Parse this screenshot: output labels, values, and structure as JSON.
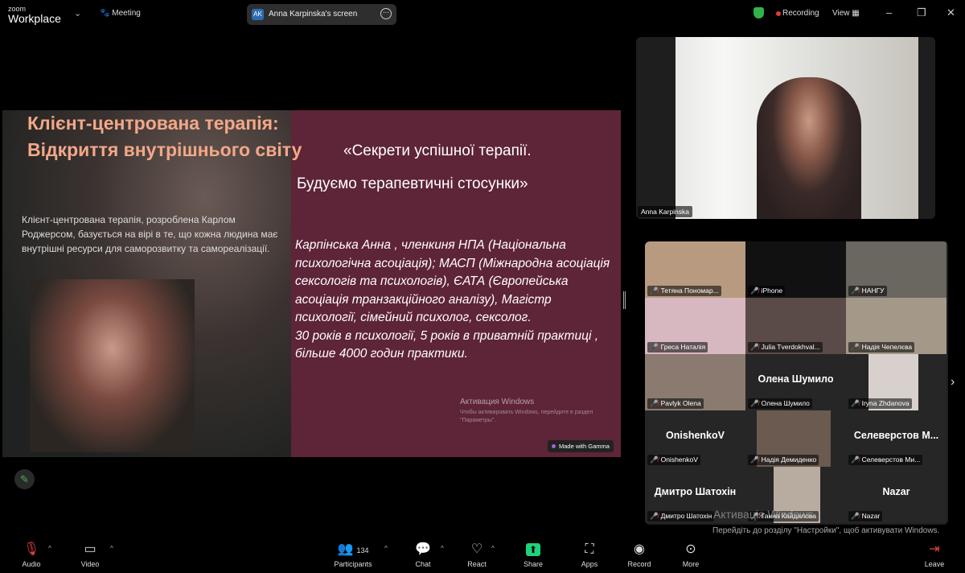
{
  "app": {
    "logo_small": "zoom",
    "logo_big": "Workplace",
    "meeting_label": "Meeting"
  },
  "share_pill": {
    "initials": "AK",
    "label": "Anna Karpinska's screen"
  },
  "status": {
    "recording": "Recording",
    "view": "View"
  },
  "slide": {
    "title": "Клієнт-центрована терапія: Відкриття внутрішнього світу",
    "body": "Клієнт-центрована терапія, розроблена Карлом Роджерсом, базується на вірі в те, що кожна людина має внутрішні ресурси для саморозвитку та самореалізації.",
    "quote_line1": "«Секрети успішної терапії.",
    "quote_line2": "Будуємо терапевтичні стосунки»",
    "bio": "Карпінська Анна , членкиня НПА (Національна психологічна асоціація); МАСП (Міжнародна асоціація сексологів та психологів), ЄАТА (Європейська асоціація транзакційного аналізу), Магістр психології, сімейний психолог, сексолог.",
    "bio2": "30 років в психології, 5 років в приватній практиці , більше 4000 годин практики.",
    "activation_title": "Активация Windows",
    "activation_text": "Чтобы активировать Windows, перейдите в раздел \"Параметры\".",
    "badge": "Made with Gamma"
  },
  "speaker": {
    "name": "Anna Karpinska"
  },
  "participants": [
    {
      "name": "Тетяна Пономар...",
      "video": true,
      "bg": "#b89a80"
    },
    {
      "name": "iPhone",
      "video": true,
      "bg": "#111"
    },
    {
      "name": "НАНГУ",
      "video": true,
      "bg": "#6a6660"
    },
    {
      "name": "Греса Наталія",
      "video": true,
      "bg": "#d8b8c0"
    },
    {
      "name": "Julia Tverdokhval...",
      "video": true,
      "bg": "#5a4a48"
    },
    {
      "name": "Надія Чепелєва",
      "video": true,
      "bg": "#a49888"
    },
    {
      "name": "Pavlyk Olena",
      "video": true,
      "bg": "#8a7a70"
    },
    {
      "name": "Олена Шумило",
      "video": false,
      "big": "Олена Шумило"
    },
    {
      "name": "Iryna Zhdanova",
      "video": true,
      "bg": "#d8d0cc"
    },
    {
      "name": "OnishenkoV",
      "video": false,
      "big": "OnishenkoV"
    },
    {
      "name": "Надія Демиденко",
      "video": true,
      "bg": "#6a5a50"
    },
    {
      "name": "Селеверстов Ми...",
      "video": false,
      "big": "Селеверстов  M..."
    },
    {
      "name": "Дмитро Шатохін",
      "video": false,
      "big": "Дмитро Шатохін"
    },
    {
      "name": "Ганна Кайдалова",
      "video": true,
      "bg": "#b8aca0"
    },
    {
      "name": "Nazar",
      "video": false,
      "big": "Nazar"
    }
  ],
  "windows_activation": {
    "title": "Активація Windows",
    "text": "Перейдіть до розділу \"Настройки\", щоб активувати Windows."
  },
  "toolbar": {
    "audio": "Audio",
    "video": "Video",
    "participants": "Participants",
    "participant_count": "134",
    "chat": "Chat",
    "react": "React",
    "share": "Share",
    "apps": "Apps",
    "record": "Record",
    "more": "More",
    "leave": "Leave"
  }
}
